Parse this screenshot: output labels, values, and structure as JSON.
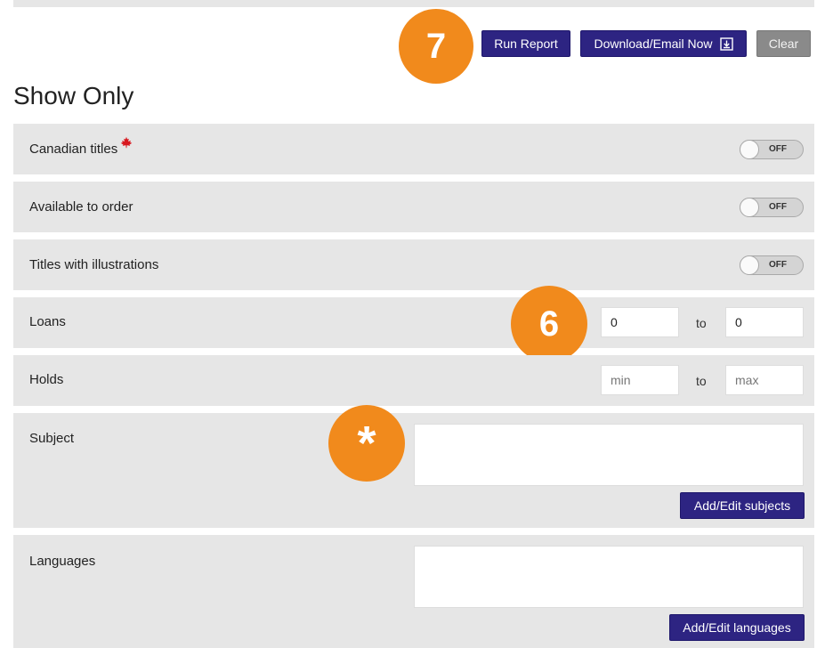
{
  "toolbar": {
    "run_report_label": "Run Report",
    "download_label": "Download/Email Now",
    "download_icon": "download-icon",
    "clear_label": "Clear",
    "primary_color": "#2d2482",
    "clear_color": "#8a8a8a"
  },
  "badges": {
    "step7": "7",
    "step6": "6",
    "asterisk": "*",
    "color": "#f18a1c"
  },
  "section_title": "Show Only",
  "filters": {
    "canadian": {
      "label": "Canadian titles",
      "icon": "maple-leaf-icon",
      "toggle_state": "OFF"
    },
    "available": {
      "label": "Available to order",
      "toggle_state": "OFF"
    },
    "illustrations": {
      "label": "Titles with illustrations",
      "toggle_state": "OFF"
    },
    "loans": {
      "label": "Loans",
      "min_value": "0",
      "to_label": "to",
      "max_value": "0"
    },
    "holds": {
      "label": "Holds",
      "min_placeholder": "min",
      "to_label": "to",
      "max_placeholder": "max"
    },
    "subject": {
      "label": "Subject",
      "button_label": "Add/Edit subjects"
    },
    "languages": {
      "label": "Languages",
      "button_label": "Add/Edit languages"
    }
  }
}
